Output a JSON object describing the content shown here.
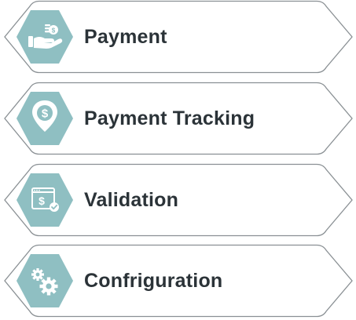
{
  "colors": {
    "hex_fill": "#8fbfc2",
    "border": "#8a9094",
    "label_text": "#2b3338",
    "icon_glyph": "#ffffff",
    "icon_accent": "#5a9aa0"
  },
  "menu": {
    "items": [
      {
        "label": "Payment",
        "icon": "hand-holding-coins-icon"
      },
      {
        "label": "Payment Tracking",
        "icon": "dollar-location-pin-icon"
      },
      {
        "label": "Validation",
        "icon": "invoice-dollar-check-icon"
      },
      {
        "label": "Confriguration",
        "icon": "gears-icon"
      }
    ]
  }
}
